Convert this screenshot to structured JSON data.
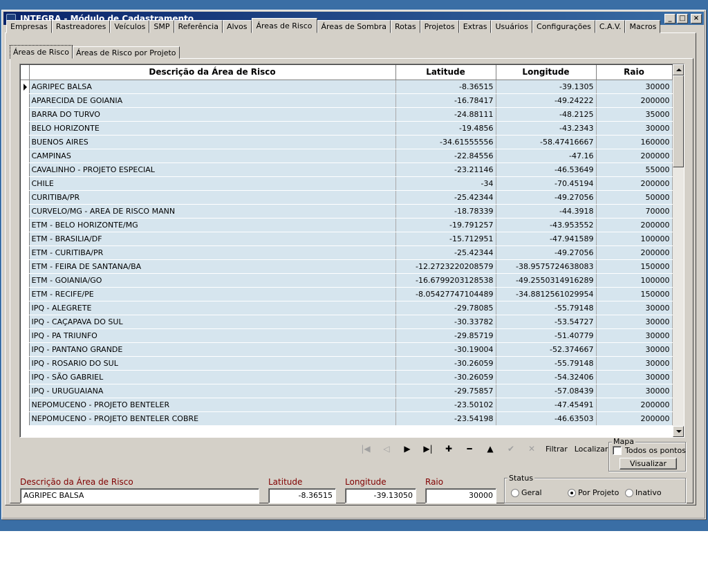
{
  "window": {
    "title": "INTEGRA - Módulo de Cadastramento",
    "controls": {
      "minimize": "_",
      "maximize": "□",
      "close": "×"
    }
  },
  "main_tabs": [
    {
      "label": "Empresas",
      "active": false
    },
    {
      "label": "Rastreadores",
      "active": false
    },
    {
      "label": "Veículos",
      "active": false
    },
    {
      "label": "SMP",
      "active": false
    },
    {
      "label": "Referência",
      "active": false
    },
    {
      "label": "Alvos",
      "active": false
    },
    {
      "label": "Áreas de Risco",
      "active": true
    },
    {
      "label": "Áreas de Sombra",
      "active": false
    },
    {
      "label": "Rotas",
      "active": false
    },
    {
      "label": "Projetos",
      "active": false
    },
    {
      "label": "Extras",
      "active": false
    },
    {
      "label": "Usuários",
      "active": false
    },
    {
      "label": "Configurações",
      "active": false
    },
    {
      "label": "C.A.V.",
      "active": false
    },
    {
      "label": "Macros",
      "active": false
    }
  ],
  "sub_tabs": [
    {
      "label": "Áreas de Risco",
      "active": true
    },
    {
      "label": "Áreas de Risco por Projeto",
      "active": false
    }
  ],
  "grid": {
    "columns": [
      "Descrição da Área de Risco",
      "Latitude",
      "Longitude",
      "Raio"
    ],
    "selected_row": 0,
    "rows": [
      [
        "AGRIPEC BALSA",
        "-8.36515",
        "-39.1305",
        "30000"
      ],
      [
        "APARECIDA DE GOIANIA",
        "-16.78417",
        "-49.24222",
        "200000"
      ],
      [
        "BARRA DO TURVO",
        "-24.88111",
        "-48.2125",
        "35000"
      ],
      [
        "BELO HORIZONTE",
        "-19.4856",
        "-43.2343",
        "30000"
      ],
      [
        "BUENOS AIRES",
        "-34.61555556",
        "-58.47416667",
        "160000"
      ],
      [
        "CAMPINAS",
        "-22.84556",
        "-47.16",
        "200000"
      ],
      [
        "CAVALINHO - PROJETO ESPECIAL",
        "-23.21146",
        "-46.53649",
        "55000"
      ],
      [
        "CHILE",
        "-34",
        "-70.45194",
        "200000"
      ],
      [
        "CURITIBA/PR",
        "-25.42344",
        "-49.27056",
        "50000"
      ],
      [
        "CURVELO/MG - AREA DE RISCO MANN",
        "-18.78339",
        "-44.3918",
        "70000"
      ],
      [
        "ETM - BELO HORIZONTE/MG",
        "-19.791257",
        "-43.953552",
        "200000"
      ],
      [
        "ETM - BRASILIA/DF",
        "-15.712951",
        "-47.941589",
        "100000"
      ],
      [
        "ETM - CURITIBA/PR",
        "-25.42344",
        "-49.27056",
        "200000"
      ],
      [
        "ETM - FEIRA DE SANTANA/BA",
        "-12.2723220208579",
        "-38.9575724638083",
        "150000"
      ],
      [
        "ETM - GOIANIA/GO",
        "-16.6799203128538",
        "-49.2550314916289",
        "100000"
      ],
      [
        "ETM - RECIFE/PE",
        "-8.05427747104489",
        "-34.8812561029954",
        "150000"
      ],
      [
        "IPQ - ALEGRETE",
        "-29.78085",
        "-55.79148",
        "30000"
      ],
      [
        "IPQ - CAÇAPAVA DO SUL",
        "-30.33782",
        "-53.54727",
        "30000"
      ],
      [
        "IPQ - PA TRIUNFO",
        "-29.85719",
        "-51.40779",
        "30000"
      ],
      [
        "IPQ - PANTANO GRANDE",
        "-30.19004",
        "-52.374667",
        "30000"
      ],
      [
        "IPQ - ROSARIO DO SUL",
        "-30.26059",
        "-55.79148",
        "30000"
      ],
      [
        "IPQ - SÃO GABRIEL",
        "-30.26059",
        "-54.32406",
        "30000"
      ],
      [
        "IPQ - URUGUAIANA",
        "-29.75857",
        "-57.08439",
        "30000"
      ],
      [
        "NEPOMUCENO - PROJETO BENTELER",
        "-23.50102",
        "-47.45491",
        "200000"
      ],
      [
        "NEPOMUCENO - PROJETO BENTELER COBRE",
        "-23.54198",
        "-46.63503",
        "200000"
      ]
    ]
  },
  "navigator": {
    "buttons": [
      {
        "icon": "first-record-icon",
        "glyph": "|◀",
        "enabled": false
      },
      {
        "icon": "prior-record-icon",
        "glyph": "◁",
        "enabled": false
      },
      {
        "icon": "next-record-icon",
        "glyph": "▶",
        "enabled": true
      },
      {
        "icon": "last-record-icon",
        "glyph": "▶|",
        "enabled": true
      },
      {
        "icon": "insert-record-icon",
        "glyph": "✚",
        "enabled": true
      },
      {
        "icon": "delete-record-icon",
        "glyph": "━",
        "enabled": true
      },
      {
        "icon": "edit-record-icon",
        "glyph": "▲",
        "enabled": true
      },
      {
        "icon": "post-record-icon",
        "glyph": "✔",
        "enabled": false
      },
      {
        "icon": "cancel-record-icon",
        "glyph": "✕",
        "enabled": false
      }
    ],
    "filter_label": "Filtrar",
    "locate_label": "Localizar"
  },
  "mapa": {
    "group_label": "Mapa",
    "all_points_label": "Todos os pontos",
    "all_points_checked": false,
    "view_button": "Visualizar"
  },
  "form": {
    "description_label": "Descrição da Área de Risco",
    "description_value": "AGRIPEC BALSA",
    "latitude_label": "Latitude",
    "latitude_value": "-8.36515",
    "longitude_label": "Longitude",
    "longitude_value": "-39.13050",
    "radius_label": "Raio",
    "radius_value": "30000",
    "label_color": "#800000"
  },
  "status": {
    "group_label": "Status",
    "options": [
      {
        "label": "Geral",
        "selected": false
      },
      {
        "label": "Por Projeto",
        "selected": true
      },
      {
        "label": "Inativo",
        "selected": false
      }
    ]
  }
}
